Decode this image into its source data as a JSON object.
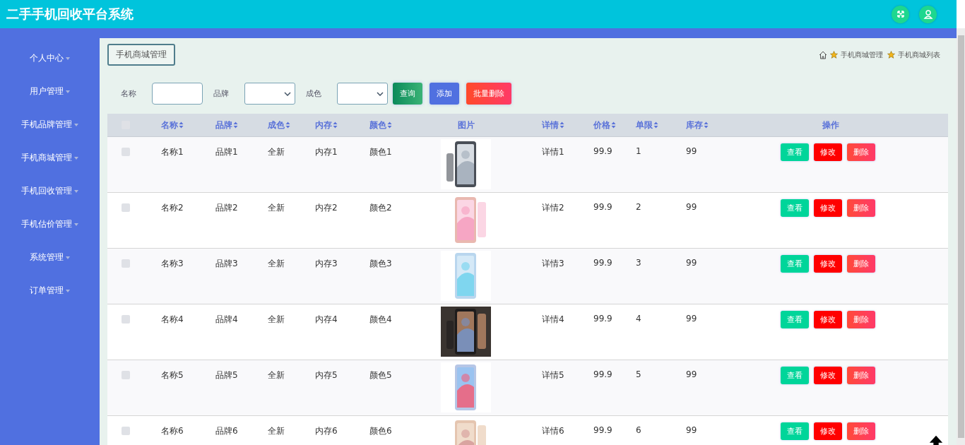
{
  "header": {
    "title": "二手手机回收平台系统",
    "icons": [
      {
        "kind": "fullscreen"
      },
      {
        "kind": "user"
      }
    ]
  },
  "sidebar": {
    "items": [
      {
        "label": "个人中心"
      },
      {
        "label": "用户管理"
      },
      {
        "label": "手机品牌管理"
      },
      {
        "label": "手机商城管理"
      },
      {
        "label": "手机回收管理"
      },
      {
        "label": "手机估价管理"
      },
      {
        "label": "系统管理"
      },
      {
        "label": "订单管理"
      }
    ]
  },
  "page_tab": "手机商城管理",
  "breadcrumb": [
    "手机商城管理",
    "手机商城列表"
  ],
  "filters": [
    {
      "kind": "text",
      "label": "名称"
    },
    {
      "kind": "select",
      "label": "品牌"
    },
    {
      "kind": "select",
      "label": "成色"
    }
  ],
  "actions": [
    {
      "kind": "search",
      "label": "查询"
    },
    {
      "kind": "add",
      "label": "添加"
    },
    {
      "kind": "batch_delete",
      "label": "批量删除"
    }
  ],
  "table": {
    "select_all_checked": false,
    "columns": [
      {
        "label": "名称",
        "sortable": true
      },
      {
        "label": "品牌",
        "sortable": true
      },
      {
        "label": "成色",
        "sortable": true
      },
      {
        "label": "内存",
        "sortable": true
      },
      {
        "label": "颜色",
        "sortable": true
      },
      {
        "label": "图片",
        "sortable": false
      },
      {
        "label": "详情",
        "sortable": true
      },
      {
        "label": "价格",
        "sortable": true
      },
      {
        "label": "单限",
        "sortable": true
      },
      {
        "label": "库存",
        "sortable": true
      },
      {
        "label": "操作",
        "sortable": false
      }
    ],
    "rows": [
      {
        "checked": false,
        "cells": [
          "名称1",
          "品牌1",
          "全新",
          "内存1",
          "颜色1",
          {
            "kind": "picture"
          },
          "详情1",
          "99.9",
          "1",
          "99",
          {
            "kind": "actions",
            "buttons": [
              {
                "kind": "view",
                "label": "查看"
              },
              {
                "kind": "edit",
                "label": "修改"
              },
              {
                "kind": "delete",
                "label": "删除"
              }
            ]
          }
        ]
      },
      {
        "checked": false,
        "cells": [
          "名称2",
          "品牌2",
          "全新",
          "内存2",
          "颜色2",
          {
            "kind": "picture"
          },
          "详情2",
          "99.9",
          "2",
          "99",
          {
            "kind": "actions",
            "buttons": [
              {
                "kind": "view",
                "label": "查看"
              },
              {
                "kind": "edit",
                "label": "修改"
              },
              {
                "kind": "delete",
                "label": "删除"
              }
            ]
          }
        ]
      },
      {
        "checked": false,
        "cells": [
          "名称3",
          "品牌3",
          "全新",
          "内存3",
          "颜色3",
          {
            "kind": "picture"
          },
          "详情3",
          "99.9",
          "3",
          "99",
          {
            "kind": "actions",
            "buttons": [
              {
                "kind": "view",
                "label": "查看"
              },
              {
                "kind": "edit",
                "label": "修改"
              },
              {
                "kind": "delete",
                "label": "删除"
              }
            ]
          }
        ]
      },
      {
        "checked": false,
        "cells": [
          "名称4",
          "品牌4",
          "全新",
          "内存4",
          "颜色4",
          {
            "kind": "picture"
          },
          "详情4",
          "99.9",
          "4",
          "99",
          {
            "kind": "actions",
            "buttons": [
              {
                "kind": "view",
                "label": "查看"
              },
              {
                "kind": "edit",
                "label": "修改"
              },
              {
                "kind": "delete",
                "label": "删除"
              }
            ]
          }
        ]
      },
      {
        "checked": false,
        "cells": [
          "名称5",
          "品牌5",
          "全新",
          "内存5",
          "颜色5",
          {
            "kind": "picture"
          },
          "详情5",
          "99.9",
          "5",
          "99",
          {
            "kind": "actions",
            "buttons": [
              {
                "kind": "view",
                "label": "查看"
              },
              {
                "kind": "edit",
                "label": "修改"
              },
              {
                "kind": "delete",
                "label": "删除"
              }
            ]
          }
        ]
      },
      {
        "checked": false,
        "cells": [
          "名称6",
          "品牌6",
          "全新",
          "内存6",
          "颜色6",
          {
            "kind": "picture"
          },
          "详情6",
          "99.9",
          "6",
          "99",
          {
            "kind": "actions",
            "buttons": [
              {
                "kind": "view",
                "label": "查看"
              },
              {
                "kind": "edit",
                "label": "修改"
              },
              {
                "kind": "delete",
                "label": "删除"
              }
            ]
          }
        ]
      }
    ]
  }
}
